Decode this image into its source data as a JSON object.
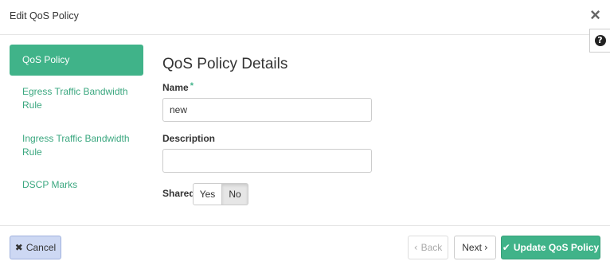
{
  "modal": {
    "title": "Edit QoS Policy",
    "close_icon": "×",
    "help_icon": "?"
  },
  "nav": {
    "items": [
      {
        "label": "QoS Policy",
        "active": true
      },
      {
        "label": "Egress Traffic Bandwidth Rule",
        "active": false
      },
      {
        "label": "Ingress Traffic Bandwidth Rule",
        "active": false
      },
      {
        "label": "DSCP Marks",
        "active": false
      }
    ]
  },
  "form": {
    "section_title": "QoS Policy Details",
    "name_label": "Name",
    "required_mark": "*",
    "name_value": "new",
    "description_label": "Description",
    "description_value": "",
    "shared_label": "Shared",
    "shared_options": [
      "Yes",
      "No"
    ],
    "shared_selected": "No"
  },
  "footer": {
    "cancel_icon": "✖",
    "cancel_label": "Cancel",
    "back_icon": "‹",
    "back_label": "Back",
    "next_label": "Next",
    "next_icon": "›",
    "update_icon": "✔",
    "update_label": "Update QoS Policy"
  },
  "colors": {
    "accent": "#40b389",
    "nav_link": "#3aa77f",
    "cancel_bg": "#cdd8f3"
  }
}
